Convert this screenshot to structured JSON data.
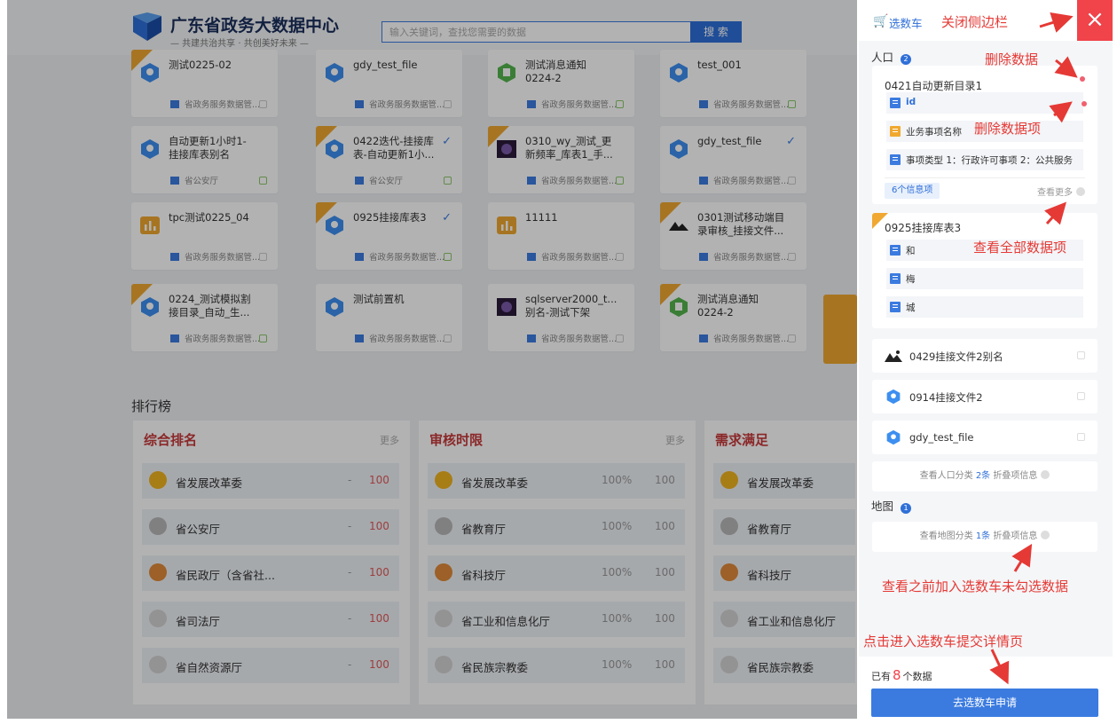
{
  "header": {
    "title": "广东省政务大数据中心",
    "subtitle": "— 共建共治共享 · 共创美好未来 —",
    "search_placeholder": "输入关键词，查找您需要的数据",
    "search_button": "搜 索"
  },
  "cards": [
    {
      "name": "测试0225-02",
      "footer": "省政务服务数据管...",
      "icon": "hex-blue-icon",
      "corner": true,
      "check": "none",
      "row": 0,
      "col": 0
    },
    {
      "name": "gdy_test_file",
      "footer": "省政务服务数据管...",
      "icon": "hex-blue-icon",
      "corner": false,
      "check": "none",
      "row": 0,
      "col": 1
    },
    {
      "name": "测试消息通知\n0224-2",
      "footer": "省政务服务数据管...",
      "icon": "hex-green-icon",
      "corner": false,
      "check": "green",
      "row": 0,
      "col": 2
    },
    {
      "name": "test_001",
      "footer": "省政务服务数据管...",
      "icon": "hex-blue-icon",
      "corner": false,
      "check": "green",
      "row": 0,
      "col": 3
    },
    {
      "name": "自动更新1小时1-\n挂接库表别名",
      "footer": "省公安厅",
      "icon": "hex-blue-icon",
      "corner": false,
      "check": "green",
      "row": 1,
      "col": 0
    },
    {
      "name": "0422迭代-挂接库\n表-自动更新1小...",
      "footer": "省公安厅",
      "icon": "hex-blue-icon",
      "corner": true,
      "check": "green",
      "tick": true,
      "row": 1,
      "col": 1
    },
    {
      "name": "0310_wy_测试_更\n新频率_库表1_手...",
      "footer": "省政务服务数据管...",
      "icon": "photo-purple-icon",
      "corner": true,
      "check": "green",
      "row": 1,
      "col": 2
    },
    {
      "name": "gdy_test_file",
      "footer": "省政务服务数据管...",
      "icon": "hex-blue-icon",
      "corner": false,
      "check": "none",
      "tick": true,
      "row": 1,
      "col": 3
    },
    {
      "name": "tpc测试0225_04",
      "footer": "省政务服务数据管...",
      "icon": "chart-orange-icon",
      "corner": false,
      "check": "none",
      "row": 2,
      "col": 0
    },
    {
      "name": "0925挂接库表3",
      "footer": "省政务服务数据管...",
      "icon": "hex-blue-icon",
      "corner": true,
      "check": "green",
      "tick": true,
      "row": 2,
      "col": 1
    },
    {
      "name": "11111",
      "footer": "省政务服务数据管...",
      "icon": "chart-orange-icon",
      "corner": false,
      "check": "none",
      "row": 2,
      "col": 2
    },
    {
      "name": "0301测试移动端目\n录审核_挂接文件...",
      "footer": "省政务服务数据管...",
      "icon": "photo-dark-icon",
      "corner": true,
      "check": "none",
      "row": 2,
      "col": 3
    },
    {
      "name": "0224_测试模拟割\n接目录_自动_生...",
      "footer": "省政务服务数据管...",
      "icon": "hex-blue-icon",
      "corner": true,
      "check": "green",
      "row": 3,
      "col": 0
    },
    {
      "name": "测试前置机",
      "footer": "省政务服务数据管...",
      "icon": "hex-blue-icon",
      "corner": false,
      "check": "none",
      "row": 3,
      "col": 1
    },
    {
      "name": "sqlserver2000_t...\n别名-测试下架",
      "footer": "省政务服务数据管...",
      "icon": "photo-purple-icon",
      "corner": false,
      "check": "none",
      "row": 3,
      "col": 2
    },
    {
      "name": "测试消息通知\n0224-2",
      "footer": "省政务服务数据管...",
      "icon": "hex-green-icon",
      "corner": true,
      "check": "none",
      "row": 3,
      "col": 3
    }
  ],
  "ranking": {
    "title": "排行榜",
    "panels": [
      {
        "title": "综合排名",
        "more": "更多",
        "rows": [
          {
            "name": "省发展改革委",
            "dash": "-",
            "value": "100",
            "medal": "m1",
            "num": "1"
          },
          {
            "name": "省公安厅",
            "dash": "-",
            "value": "100",
            "medal": "m2",
            "num": "2"
          },
          {
            "name": "省民政厅（含省社...",
            "dash": "-",
            "value": "100",
            "medal": "m3",
            "num": "3"
          },
          {
            "name": "省司法厅",
            "dash": "-",
            "value": "100",
            "medal": "mx",
            "num": "4"
          },
          {
            "name": "省自然资源厅",
            "dash": "-",
            "value": "100",
            "medal": "mx",
            "num": "5"
          }
        ]
      },
      {
        "title": "审核时限",
        "more": "更多",
        "rows": [
          {
            "name": "省发展改革委",
            "pct": "100%",
            "value": "100",
            "medal": "m1",
            "num": "1"
          },
          {
            "name": "省教育厅",
            "pct": "100%",
            "value": "100",
            "medal": "m2",
            "num": "2"
          },
          {
            "name": "省科技厅",
            "pct": "100%",
            "value": "100",
            "medal": "m3",
            "num": "3"
          },
          {
            "name": "省工业和信息化厅",
            "pct": "100%",
            "value": "100",
            "medal": "mx",
            "num": "4"
          },
          {
            "name": "省民族宗教委",
            "pct": "100%",
            "value": "100",
            "medal": "mx",
            "num": "5"
          }
        ]
      },
      {
        "title": "需求满足",
        "more": "",
        "rows": [
          {
            "name": "省发展改革委",
            "medal": "m1",
            "num": "1"
          },
          {
            "name": "省教育厅",
            "medal": "m2",
            "num": "2"
          },
          {
            "name": "省科技厅",
            "medal": "m3",
            "num": "3"
          },
          {
            "name": "省工业和信息化厅",
            "medal": "mx",
            "num": "4"
          },
          {
            "name": "省民族宗教委",
            "medal": "mx",
            "num": "5"
          }
        ]
      }
    ]
  },
  "sidebar": {
    "title": "选数车",
    "close_label": "×",
    "group1": {
      "label": "人口",
      "badge": "2"
    },
    "group2": {
      "label": "地图",
      "badge": "1"
    },
    "card1": {
      "title": "0421自动更新目录1",
      "fields": [
        "id",
        "业务事项名称",
        "事项类型 1：行政许可事项 2：公共服务"
      ],
      "info_tag": "6个信息项",
      "see_more": "查看更多"
    },
    "card2": {
      "title": "0925挂接库表3",
      "fields": [
        "和",
        "梅",
        "城"
      ]
    },
    "items": [
      "0429挂接文件2别名",
      "0914挂接文件2",
      "gdy_test_file"
    ],
    "view_pop": {
      "prefix": "查看人口分类",
      "count": "2条",
      "suffix": "折叠项信息"
    },
    "view_map": {
      "prefix": "查看地图分类",
      "count": "1条",
      "suffix": "折叠项信息"
    },
    "have_prefix": "已有",
    "have_count": "8",
    "have_suffix": "个数据",
    "apply_button": "去选数车申请"
  },
  "annotations": {
    "close_sidebar": "关闭侧边栏",
    "delete_data": "删除数据",
    "delete_item": "删除数据项",
    "view_all": "查看全部数据项",
    "view_unchecked": "查看之前加入选数车未勾选数据",
    "enter_detail": "点击进入选数车提交详情页"
  },
  "colors": {
    "accent": "#2f6fd8",
    "close": "#f0434a",
    "annotation": "#e53935",
    "rank_title": "#c8393a"
  }
}
